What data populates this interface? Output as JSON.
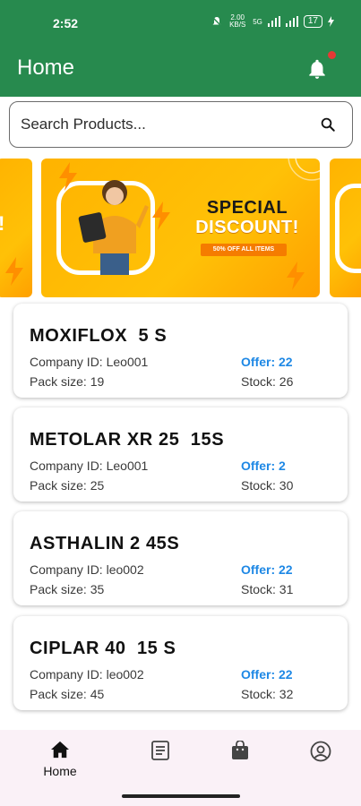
{
  "status_bar": {
    "time": "2:52",
    "speed": "2.00 KB/S",
    "network": "5G",
    "battery": "17"
  },
  "app_bar": {
    "title": "Home",
    "notification_icon": "bell-icon",
    "has_notification_dot": true
  },
  "search": {
    "placeholder": "Search Products...",
    "icon": "search-icon"
  },
  "banner": {
    "main": {
      "headline_1": "SPECIAL",
      "headline_2": "DISCOUNT!",
      "tagline": "50% OFF ALL ITEMS"
    },
    "left_peek_text": "!"
  },
  "products": [
    {
      "name": "MOXIFLOX  5 S",
      "company_id": "Company ID: Leo001",
      "pack_size": "Pack size: 19",
      "offer": "Offer: 22",
      "stock": "Stock: 26"
    },
    {
      "name": "METOLAR XR 25  15S",
      "company_id": "Company ID: Leo001",
      "pack_size": "Pack size: 25",
      "offer": "Offer: 2",
      "stock": "Stock: 30"
    },
    {
      "name": "ASTHALIN 2 45S",
      "company_id": "Company ID: leo002",
      "pack_size": "Pack size: 35",
      "offer": "Offer: 22",
      "stock": "Stock: 31"
    },
    {
      "name": "CIPLAR 40  15 S",
      "company_id": "Company ID: leo002",
      "pack_size": "Pack size: 45",
      "offer": "Offer: 22",
      "stock": "Stock: 32"
    }
  ],
  "bottom_nav": {
    "home_label": "Home",
    "items": [
      "home-icon",
      "orders-icon",
      "bag-icon",
      "profile-icon"
    ],
    "active": "home"
  },
  "colors": {
    "primary": "#278a4e",
    "offer": "#1e88e5",
    "banner": "#ffb300",
    "nav_background": "#faf1f7"
  }
}
